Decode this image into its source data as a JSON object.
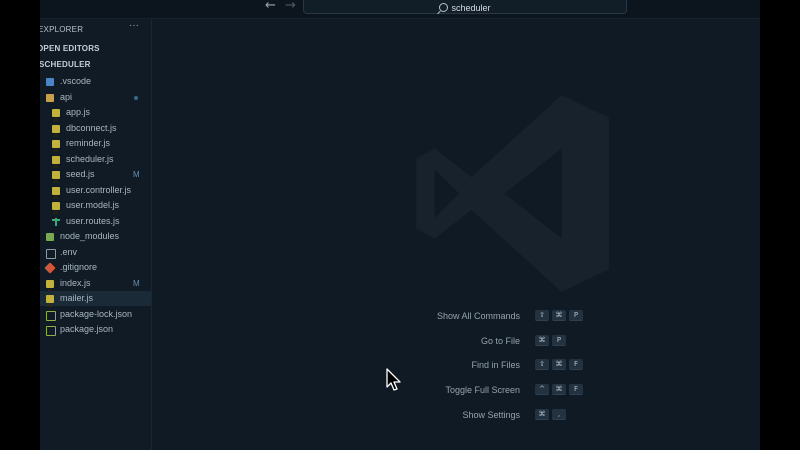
{
  "titlebar": {
    "back_icon": "←",
    "forward_icon": "→",
    "search_text": "scheduler"
  },
  "sidebar": {
    "header": "EXPLORER",
    "more_icon": "···",
    "open_editors": "OPEN EDITORS",
    "project": "SCHEDULER",
    "items": [
      {
        "label": ".vscode",
        "icon": "folder-icon",
        "indent": 0
      },
      {
        "label": "api",
        "icon": "folder-open-icon",
        "indent": 0,
        "dot": true
      },
      {
        "label": "app.js",
        "icon": "js-file-icon",
        "indent": 1
      },
      {
        "label": "dbconnect.js",
        "icon": "js-file-icon",
        "indent": 1
      },
      {
        "label": "reminder.js",
        "icon": "js-file-icon",
        "indent": 1
      },
      {
        "label": "scheduler.js",
        "icon": "js-file-icon",
        "indent": 1
      },
      {
        "label": "seed.js",
        "icon": "js-file-icon",
        "indent": 1,
        "badge": "M"
      },
      {
        "label": "user.controller.js",
        "icon": "js-file-icon",
        "indent": 1
      },
      {
        "label": "user.model.js",
        "icon": "js-file-icon",
        "indent": 1
      },
      {
        "label": "user.routes.js",
        "icon": "routes-file-icon",
        "indent": 1
      },
      {
        "label": "node_modules",
        "icon": "node-modules-folder-icon",
        "indent": 0
      },
      {
        "label": ".env",
        "icon": "env-file-icon",
        "indent": 0
      },
      {
        "label": ".gitignore",
        "icon": "git-file-icon",
        "indent": 0
      },
      {
        "label": "index.js",
        "icon": "js-file-icon",
        "indent": 0,
        "badge": "M"
      },
      {
        "label": "mailer.js",
        "icon": "js-file-icon",
        "indent": 0,
        "selected": true
      },
      {
        "label": "package-lock.json",
        "icon": "json-file-icon",
        "indent": 0
      },
      {
        "label": "package.json",
        "icon": "json-file-icon",
        "indent": 0
      }
    ]
  },
  "shortcuts": [
    {
      "label": "Show All Commands",
      "keys": [
        "⇧",
        "⌘",
        "P"
      ]
    },
    {
      "label": "Go to File",
      "keys": [
        "⌘",
        "P"
      ]
    },
    {
      "label": "Find in Files",
      "keys": [
        "⇧",
        "⌘",
        "F"
      ]
    },
    {
      "label": "Toggle Full Screen",
      "keys": [
        "^",
        "⌘",
        "F"
      ]
    },
    {
      "label": "Show Settings",
      "keys": [
        "⌘",
        ","
      ]
    }
  ],
  "colors": {
    "background": "#0f1a24",
    "sidebar": "#101b25",
    "selected_row": "#1b2a37",
    "watermark": "#17222d"
  }
}
